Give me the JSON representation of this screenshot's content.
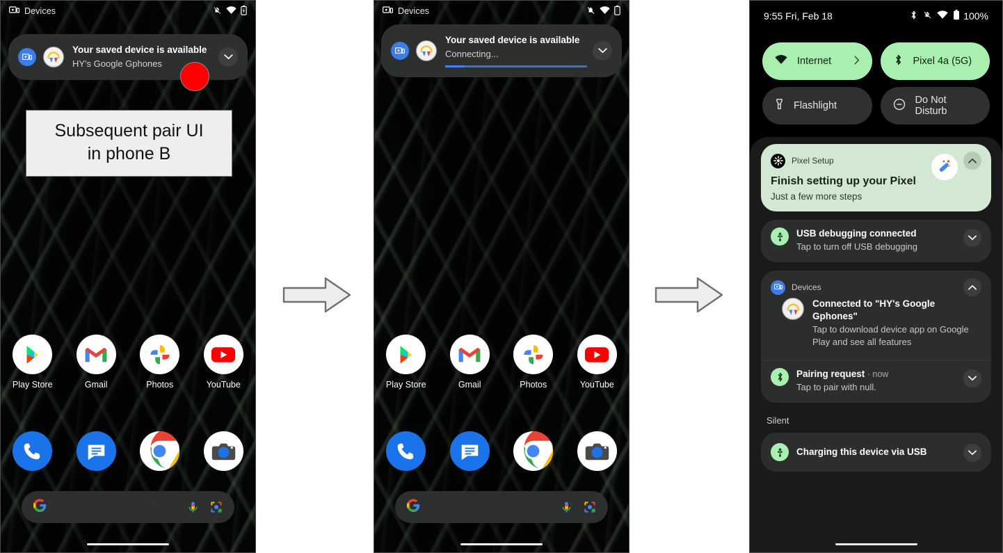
{
  "phone_a": {
    "status_bar": {
      "app_label": "Devices",
      "icons": [
        "devices-icon",
        "bell-muted-icon",
        "wifi-icon",
        "battery-icon"
      ]
    },
    "heads_up": {
      "app_icon": "devices-icon",
      "avatar": "earbuds-avatar-icon",
      "title": "Your saved device is available",
      "subtitle": "HY's Google Gphones",
      "chevron": "chevron-down-icon"
    },
    "callout": {
      "line1": "Subsequent pair UI",
      "line2": "in phone B"
    },
    "apps": [
      {
        "label": "Play Store",
        "icon": "play-store-icon"
      },
      {
        "label": "Gmail",
        "icon": "gmail-icon"
      },
      {
        "label": "Photos",
        "icon": "google-photos-icon"
      },
      {
        "label": "YouTube",
        "icon": "youtube-icon"
      }
    ],
    "dock": [
      {
        "label": "Phone",
        "icon": "phone-icon"
      },
      {
        "label": "Messages",
        "icon": "messages-icon"
      },
      {
        "label": "Chrome",
        "icon": "chrome-icon"
      },
      {
        "label": "Camera",
        "icon": "camera-icon"
      }
    ],
    "search": {
      "logo": "google-g-icon",
      "mic": "microphone-icon",
      "lens": "google-lens-icon",
      "placeholder": ""
    }
  },
  "phone_b": {
    "status_bar": {
      "app_label": "Devices"
    },
    "heads_up": {
      "app_icon": "devices-icon",
      "avatar": "earbuds-avatar-icon",
      "title": "Your saved device is available",
      "subtitle": "Connecting...",
      "chevron": "chevron-down-icon",
      "progress_percent": 13
    },
    "apps": [
      {
        "label": "Play Store",
        "icon": "play-store-icon"
      },
      {
        "label": "Gmail",
        "icon": "gmail-icon"
      },
      {
        "label": "Photos",
        "icon": "google-photos-icon"
      },
      {
        "label": "YouTube",
        "icon": "youtube-icon"
      }
    ],
    "dock": [
      {
        "label": "Phone",
        "icon": "phone-icon"
      },
      {
        "label": "Messages",
        "icon": "messages-icon"
      },
      {
        "label": "Chrome",
        "icon": "chrome-icon"
      },
      {
        "label": "Camera",
        "icon": "camera-icon"
      }
    ]
  },
  "phone_c": {
    "status_bar": {
      "time": "9:55 Fri, Feb 18",
      "battery_percent": "100%",
      "icons": [
        "bluetooth-icon",
        "bell-muted-icon",
        "wifi-icon",
        "battery-icon"
      ]
    },
    "tiles": [
      {
        "label": "Internet",
        "icon": "wifi-icon",
        "state": "on",
        "chevron": "chevron-right-icon"
      },
      {
        "label": "Pixel 4a (5G)",
        "icon": "bluetooth-icon",
        "state": "on"
      },
      {
        "label": "Flashlight",
        "icon": "flashlight-icon",
        "state": "off"
      },
      {
        "label": "Do Not Disturb",
        "icon": "do-not-disturb-icon",
        "state": "off"
      }
    ],
    "notifications": [
      {
        "app": "Pixel Setup",
        "app_icon": "pixel-setup-icon",
        "title": "Finish setting up your Pixel",
        "subtitle": "Just a few more steps",
        "big_icon": "magic-wand-icon",
        "chevron": "chevron-up-icon",
        "style": "green"
      },
      {
        "app": "",
        "app_icon": "usb-icon",
        "title": "USB debugging connected",
        "subtitle": "Tap to turn off USB debugging",
        "chevron": "chevron-down-icon",
        "style": "dark"
      },
      {
        "app": "Devices",
        "app_icon": "devices-icon",
        "title": "Connected to \"HY's Google Gphones\"",
        "subtitle": "Tap to download device app on Google Play and see all features",
        "avatar": "earbuds-avatar-icon",
        "chevron": "chevron-up-icon",
        "style": "dark-group"
      },
      {
        "app": "",
        "app_icon": "bluetooth-icon",
        "title": "Pairing request",
        "time": "now",
        "subtitle": "Tap to pair with null.",
        "chevron": "chevron-down-icon",
        "style": "dark"
      }
    ],
    "silent_section": {
      "label": "Silent",
      "items": [
        {
          "app_icon": "usb-icon",
          "title": "Charging this device via USB",
          "chevron": "chevron-down-icon"
        }
      ]
    }
  },
  "annotations": {
    "arrows": [
      "arrow-right-1",
      "arrow-right-2"
    ],
    "red_marker": "red-circle-highlight"
  },
  "colors": {
    "tile_on": "#a8efb0",
    "tile_off": "#303030",
    "notif_green": "#d3e8d3",
    "notif_dark": "#2c2d2d",
    "progress": "#4285f4",
    "red_marker": "#fe0000"
  }
}
